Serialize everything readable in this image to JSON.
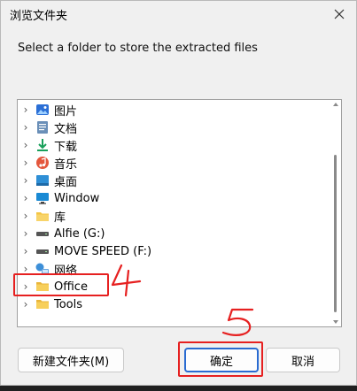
{
  "window": {
    "title": "浏览文件夹"
  },
  "instruction": "Select a folder to store the extracted files",
  "tree": {
    "items": [
      {
        "label": "图片",
        "icon": "pictures-icon"
      },
      {
        "label": "文档",
        "icon": "documents-icon"
      },
      {
        "label": "下载",
        "icon": "downloads-icon"
      },
      {
        "label": "音乐",
        "icon": "music-icon"
      },
      {
        "label": "桌面",
        "icon": "desktop-icon"
      },
      {
        "label": "Window",
        "icon": "monitor-icon"
      },
      {
        "label": "库",
        "icon": "library-folder-icon"
      },
      {
        "label": "Alfie (G:)",
        "icon": "drive-icon"
      },
      {
        "label": "MOVE SPEED (F:)",
        "icon": "drive-icon"
      },
      {
        "label": "网络",
        "icon": "network-icon"
      },
      {
        "label": "Office",
        "icon": "folder-icon"
      },
      {
        "label": "Tools",
        "icon": "folder-icon"
      }
    ]
  },
  "buttons": {
    "new_folder": "新建文件夹(M)",
    "ok": "确定",
    "cancel": "取消"
  },
  "annotations": {
    "step_4": "4",
    "step_5": "5"
  },
  "colors": {
    "accent": "#2a6bd1",
    "annotation": "#e62020",
    "folder": "#f4c542"
  }
}
